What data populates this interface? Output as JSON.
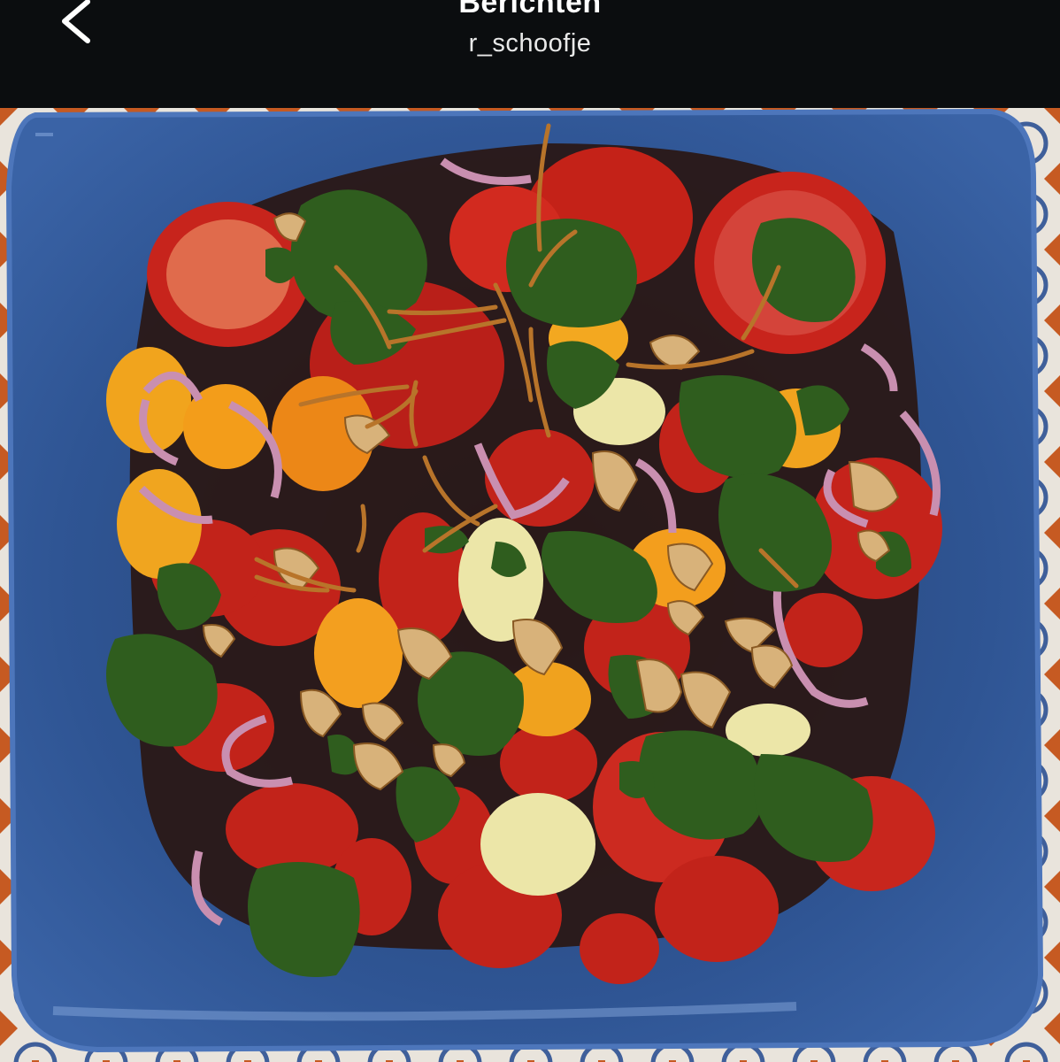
{
  "header": {
    "title": "Berichten",
    "subtitle": "r_schoofje",
    "back_icon": "chevron-left-icon"
  },
  "post": {
    "image_subject": "tomato salad"
  },
  "colors": {
    "bar_background": "#0b0d0f",
    "plate_blue": "#2f4f8f",
    "tomato_red": "#c8241c",
    "tomato_yellow": "#f0a11c",
    "cilantro_green": "#2f5a1f"
  }
}
